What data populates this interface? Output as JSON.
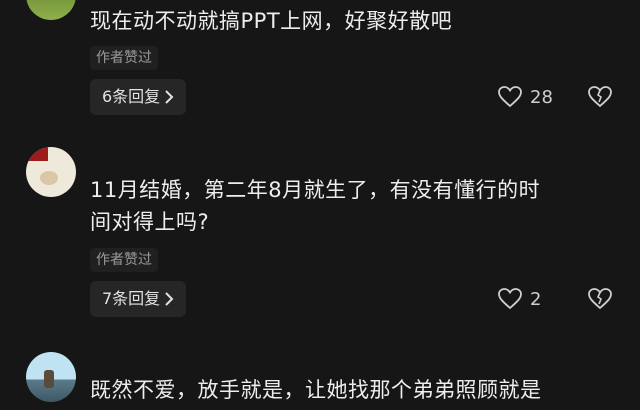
{
  "comments": [
    {
      "text": "现在动不动就搞PPT上网，好聚好散吧",
      "author_liked": "作者赞过",
      "replies_label": "6条回复",
      "likes": "28"
    },
    {
      "text": "11月结婚，第二年8月就生了，有没有懂行的时间对得上吗?",
      "author_liked": "作者赞过",
      "replies_label": "7条回复",
      "likes": "2"
    },
    {
      "text": "既然不爱，放手就是，让她找那个弟弟照顾就是"
    }
  ],
  "icons": {
    "chevron": "chevron-right-icon",
    "like": "heart-outline-icon",
    "dislike": "broken-heart-icon"
  },
  "colors": {
    "background": "#161616",
    "text": "#ededed",
    "muted": "#9a9a9a",
    "pill": "#262626"
  }
}
